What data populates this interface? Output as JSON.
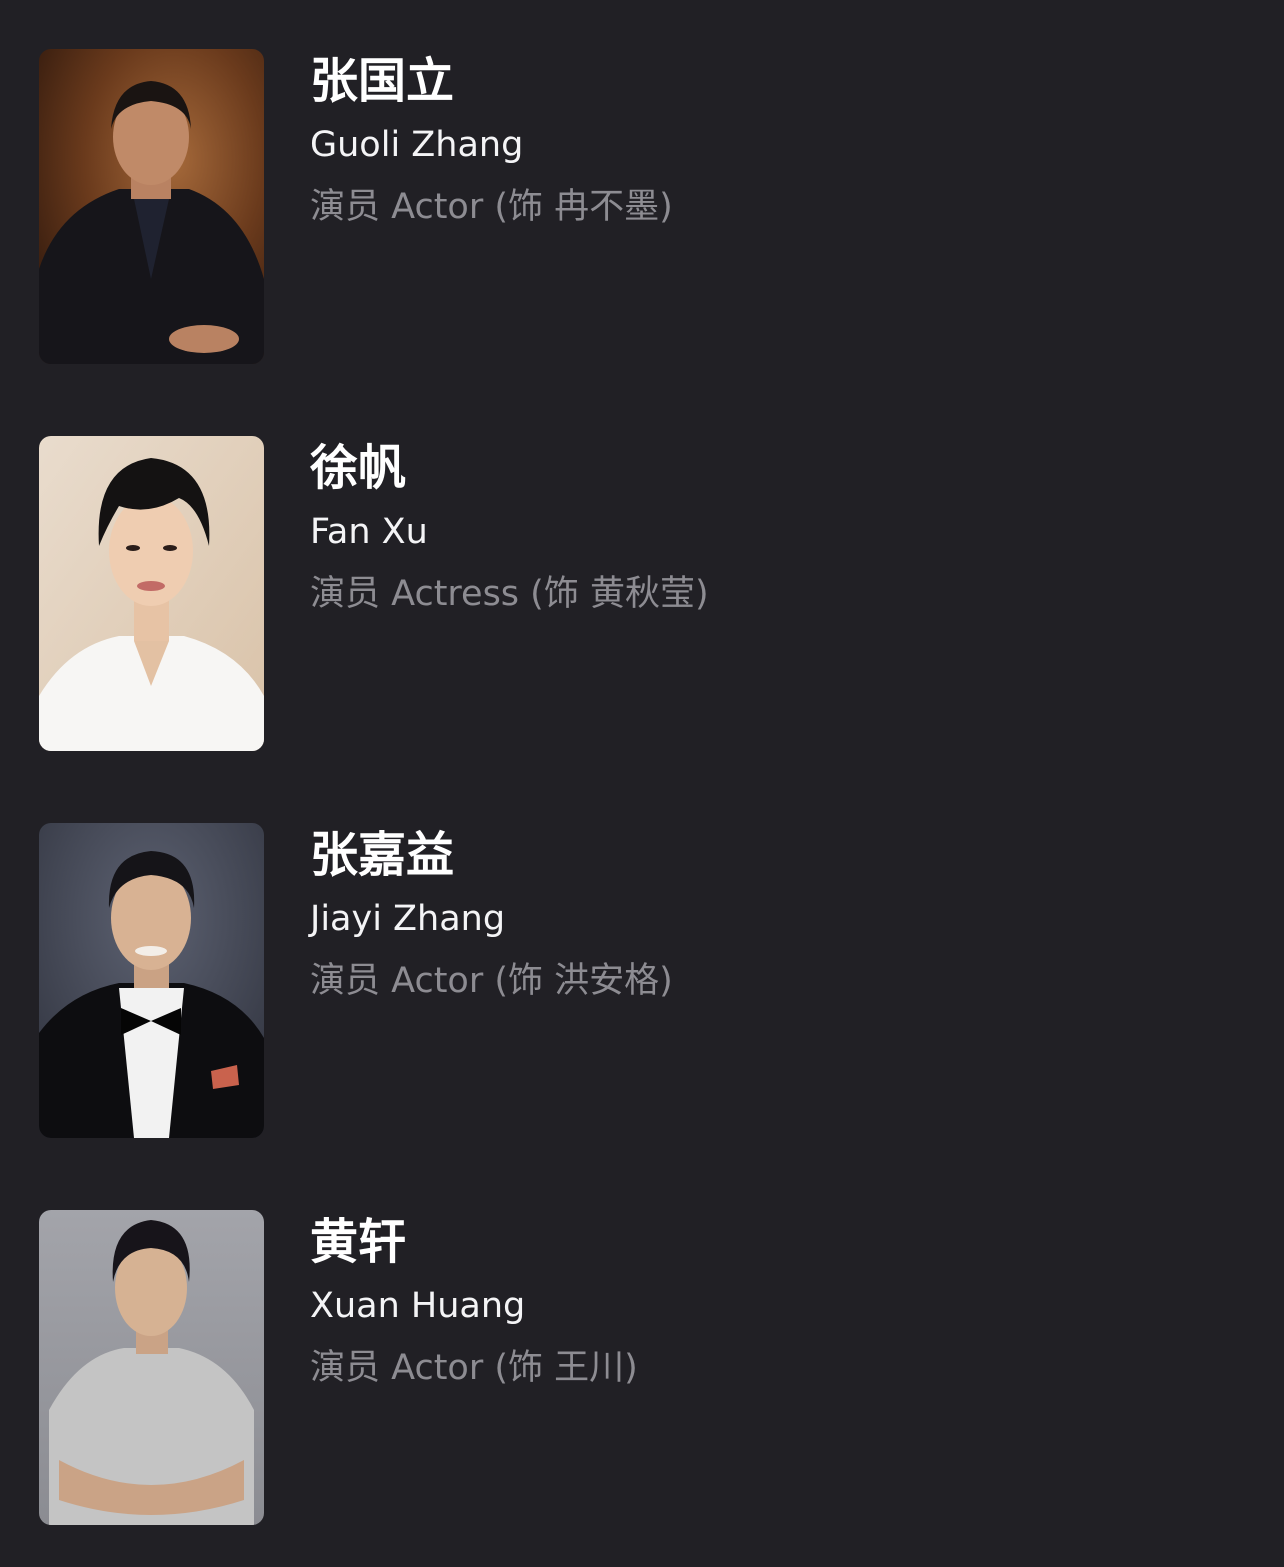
{
  "cast": [
    {
      "name_zh": "张国立",
      "name_en": "Guoli Zhang",
      "role": "演员 Actor (饰 冉不墨)"
    },
    {
      "name_zh": "徐帆",
      "name_en": "Fan Xu",
      "role": "演员 Actress (饰 黄秋莹)"
    },
    {
      "name_zh": "张嘉益",
      "name_en": "Jiayi Zhang",
      "role": "演员 Actor (饰 洪安格)"
    },
    {
      "name_zh": "黄轩",
      "name_en": "Xuan Huang",
      "role": "演员 Actor (饰 王川)"
    }
  ]
}
